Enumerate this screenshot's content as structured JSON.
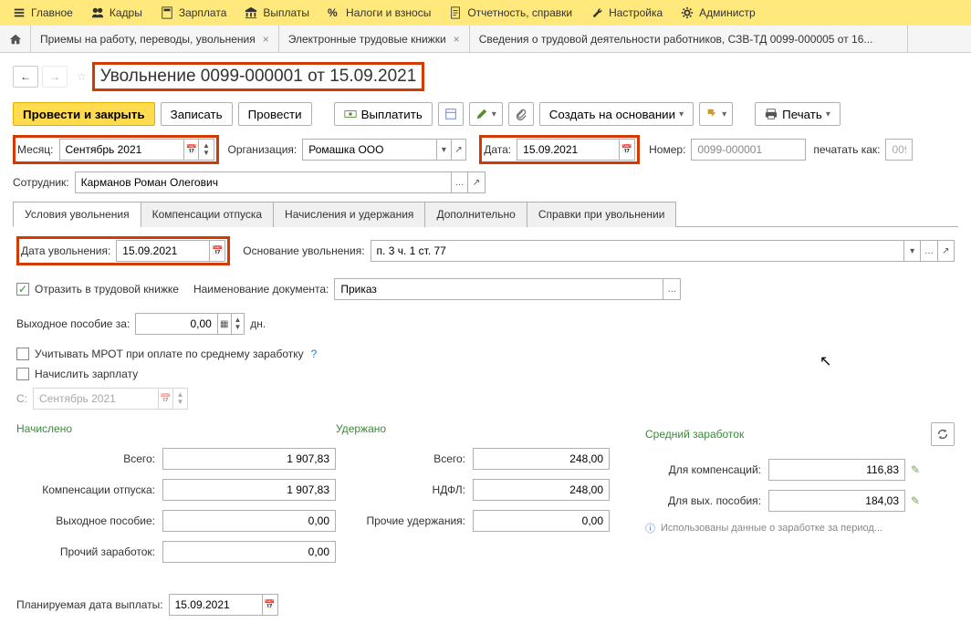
{
  "topmenu": {
    "main": "Главное",
    "hr": "Кадры",
    "salary": "Зарплата",
    "payments": "Выплаты",
    "taxes": "Налоги и взносы",
    "reports": "Отчетность, справки",
    "settings": "Настройка",
    "admin": "Администр"
  },
  "tabs": {
    "t1": "Приемы на работу, переводы, увольнения",
    "t2": "Электронные трудовые книжки",
    "t3": "Сведения о трудовой деятельности работников, СЗВ-ТД 0099-000005 от 16..."
  },
  "title": "Увольнение 0099-000001 от 15.09.2021",
  "toolbar": {
    "post_close": "Провести и закрыть",
    "save": "Записать",
    "post": "Провести",
    "pay": "Выплатить",
    "create_based": "Создать на основании",
    "print": "Печать"
  },
  "fields": {
    "month_lbl": "Месяц:",
    "month_val": "Сентябрь 2021",
    "org_lbl": "Организация:",
    "org_val": "Ромашка ООО",
    "date_lbl": "Дата:",
    "date_val": "15.09.2021",
    "num_lbl": "Номер:",
    "num_val": "0099-000001",
    "print_as_lbl": "печатать как:",
    "print_as_val": "009",
    "emp_lbl": "Сотрудник:",
    "emp_val": "Карманов Роман Олегович"
  },
  "formtabs": {
    "t1": "Условия увольнения",
    "t2": "Компенсации отпуска",
    "t3": "Начисления и удержания",
    "t4": "Дополнительно",
    "t5": "Справки при увольнении"
  },
  "dismiss": {
    "date_lbl": "Дата увольнения:",
    "date_val": "15.09.2021",
    "reason_lbl": "Основание увольнения:",
    "reason_val": "п. 3 ч. 1 ст. 77",
    "reflect_lbl": "Отразить в трудовой книжке",
    "docname_lbl": "Наименование документа:",
    "docname_val": "Приказ",
    "severance_lbl": "Выходное пособие за:",
    "severance_val": "0,00",
    "severance_unit": "дн.",
    "mrot_lbl": "Учитывать МРОТ при оплате по среднему заработку",
    "calc_salary_lbl": "Начислить зарплату",
    "from_lbl": "С:",
    "from_val": "Сентябрь 2021"
  },
  "calcs": {
    "accrued_hd": "Начислено",
    "withheld_hd": "Удержано",
    "avg_hd": "Средний заработок",
    "total_lbl": "Всего:",
    "vac_comp_lbl": "Компенсации отпуска:",
    "severance_lbl": "Выходное пособие:",
    "other_earn_lbl": "Прочий заработок:",
    "ndfl_lbl": "НДФЛ:",
    "other_deduct_lbl": "Прочие удержания:",
    "for_comp_lbl": "Для компенсаций:",
    "for_sev_lbl": "Для вых. пособия:",
    "accrued_total": "1 907,83",
    "accrued_vac": "1 907,83",
    "accrued_sev": "0,00",
    "accrued_other": "0,00",
    "withheld_total": "248,00",
    "withheld_ndfl": "248,00",
    "withheld_other": "0,00",
    "avg_comp": "116,83",
    "avg_sev": "184,03",
    "note": "Использованы данные о заработке за период...",
    "plan_pay_lbl": "Планируемая дата выплаты:",
    "plan_pay_val": "15.09.2021"
  }
}
